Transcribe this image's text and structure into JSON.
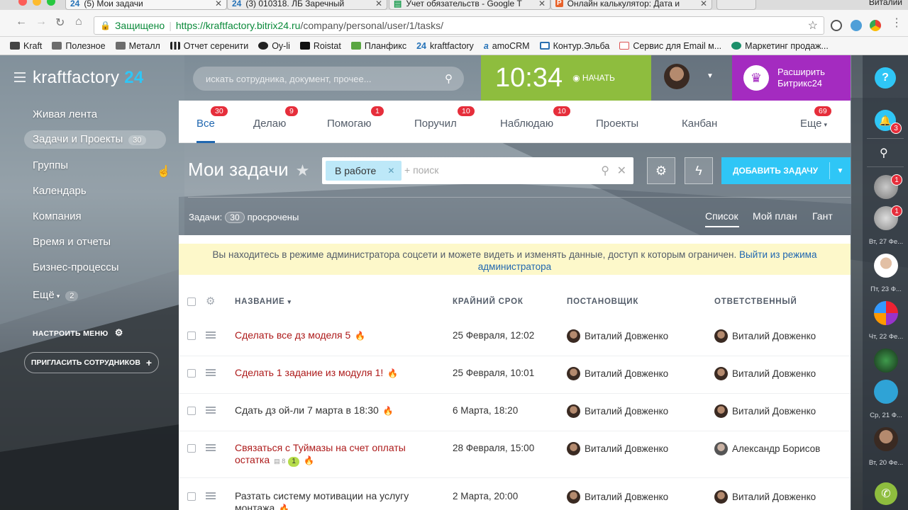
{
  "browser": {
    "tabs": [
      {
        "icon": "24",
        "title": "(5) Мои задачи"
      },
      {
        "icon": "24",
        "title": "(3) 010318. ЛБ Заречный"
      },
      {
        "icon": "sheet",
        "title": "Учет обязательств - Google Т"
      },
      {
        "icon": "calc",
        "title": "Онлайн калькулятор: Дата и"
      }
    ],
    "profile": "Виталий",
    "secure_label": "Защищено",
    "url_host": "https://kraftfactory.bitrix24.ru",
    "url_path": "/company/personal/user/1/tasks/",
    "bookmarks": [
      "Kraft",
      "Полезное",
      "Металл",
      "Отчет серенити",
      "Oy-li",
      "Roistat",
      "Планфикс",
      "kraftfactory",
      "amoCRM",
      "Контур.Эльба",
      "Сервис для Email м...",
      "Маркетинг продаж..."
    ]
  },
  "app": {
    "logo_text": "kraftfactory",
    "logo_number": "24",
    "search_placeholder": "искать сотрудника, документ, прочее...",
    "clock": "10:34",
    "start_label": "НАЧАТЬ",
    "extend_label": "Расширить Битрикс24"
  },
  "sidebar": {
    "items": [
      {
        "label": "Живая лента"
      },
      {
        "label": "Задачи и Проекты",
        "count": "30",
        "active": true
      },
      {
        "label": "Группы"
      },
      {
        "label": "Календарь"
      },
      {
        "label": "Компания"
      },
      {
        "label": "Время и отчеты"
      },
      {
        "label": "Бизнес-процессы"
      },
      {
        "label": "Ещё",
        "count": "2"
      }
    ],
    "configure_label": "НАСТРОИТЬ МЕНЮ",
    "invite_label": "ПРИГЛАСИТЬ СОТРУДНИКОВ"
  },
  "tabs": [
    {
      "label": "Все",
      "badge": "30",
      "active": true
    },
    {
      "label": "Делаю",
      "badge": "9"
    },
    {
      "label": "Помогаю",
      "badge": "1"
    },
    {
      "label": "Поручил",
      "badge": "10"
    },
    {
      "label": "Наблюдаю",
      "badge": "10"
    },
    {
      "label": "Проекты",
      "badge": ""
    },
    {
      "label": "Канбан",
      "badge": ""
    },
    {
      "label": "Еще",
      "badge": "69"
    }
  ],
  "toolbar": {
    "title": "Мои задачи",
    "filter_chip": "В работе",
    "filter_placeholder": "+ поиск",
    "add_task_label": "ДОБАВИТЬ ЗАДАЧУ"
  },
  "counters": {
    "label": "Задачи:",
    "count": "30",
    "suffix": "просрочены"
  },
  "views": [
    "Список",
    "Мой план",
    "Гант"
  ],
  "notice": {
    "text": "Вы находитесь в режиме администратора соцсети и можете видеть и изменять данные, доступ к которым ограничен.",
    "link": "Выйти из режима администратора"
  },
  "columns": [
    "НАЗВАНИЕ",
    "КРАЙНИЙ СРОК",
    "ПОСТАНОВЩИК",
    "ОТВЕТСТВЕННЫЙ"
  ],
  "tasks": [
    {
      "name": "Сделать все дз моделя 5",
      "deadline": "25 Февраля, 12:02",
      "creator": "Виталий Довженко",
      "responsible": "Виталий Довженко",
      "overdue": true
    },
    {
      "name": "Сделать 1 задание из модуля 1!",
      "deadline": "25 Февраля, 10:01",
      "creator": "Виталий Довженко",
      "responsible": "Виталий Довженко",
      "overdue": true
    },
    {
      "name": "Сдать дз ой-ли 7 марта в 18:30",
      "deadline": "6 Марта, 18:20",
      "creator": "Виталий Довженко",
      "responsible": "Виталий Довженко",
      "overdue": false
    },
    {
      "name": "Связаться с Туймазы на счет оплаты остатка",
      "deadline": "28 Февраля, 15:00",
      "creator": "Виталий Довженко",
      "responsible": "Александр Борисов",
      "overdue": true,
      "comments": "8",
      "new": "1"
    },
    {
      "name": "Разтать систему мотивации на услугу монтажа",
      "deadline": "2 Марта, 20:00",
      "creator": "Виталий Довженко",
      "responsible": "Виталий Довженко",
      "overdue": false
    }
  ],
  "right_panel": {
    "bell_badge": "3",
    "avatar_badges": [
      "1",
      "1"
    ],
    "dates": [
      "Вт, 27 Фе...",
      "Пт, 23 Ф...",
      "Чт, 22 Фе...",
      "Ср, 21 Ф...",
      "Вт, 20 Фе..."
    ]
  }
}
